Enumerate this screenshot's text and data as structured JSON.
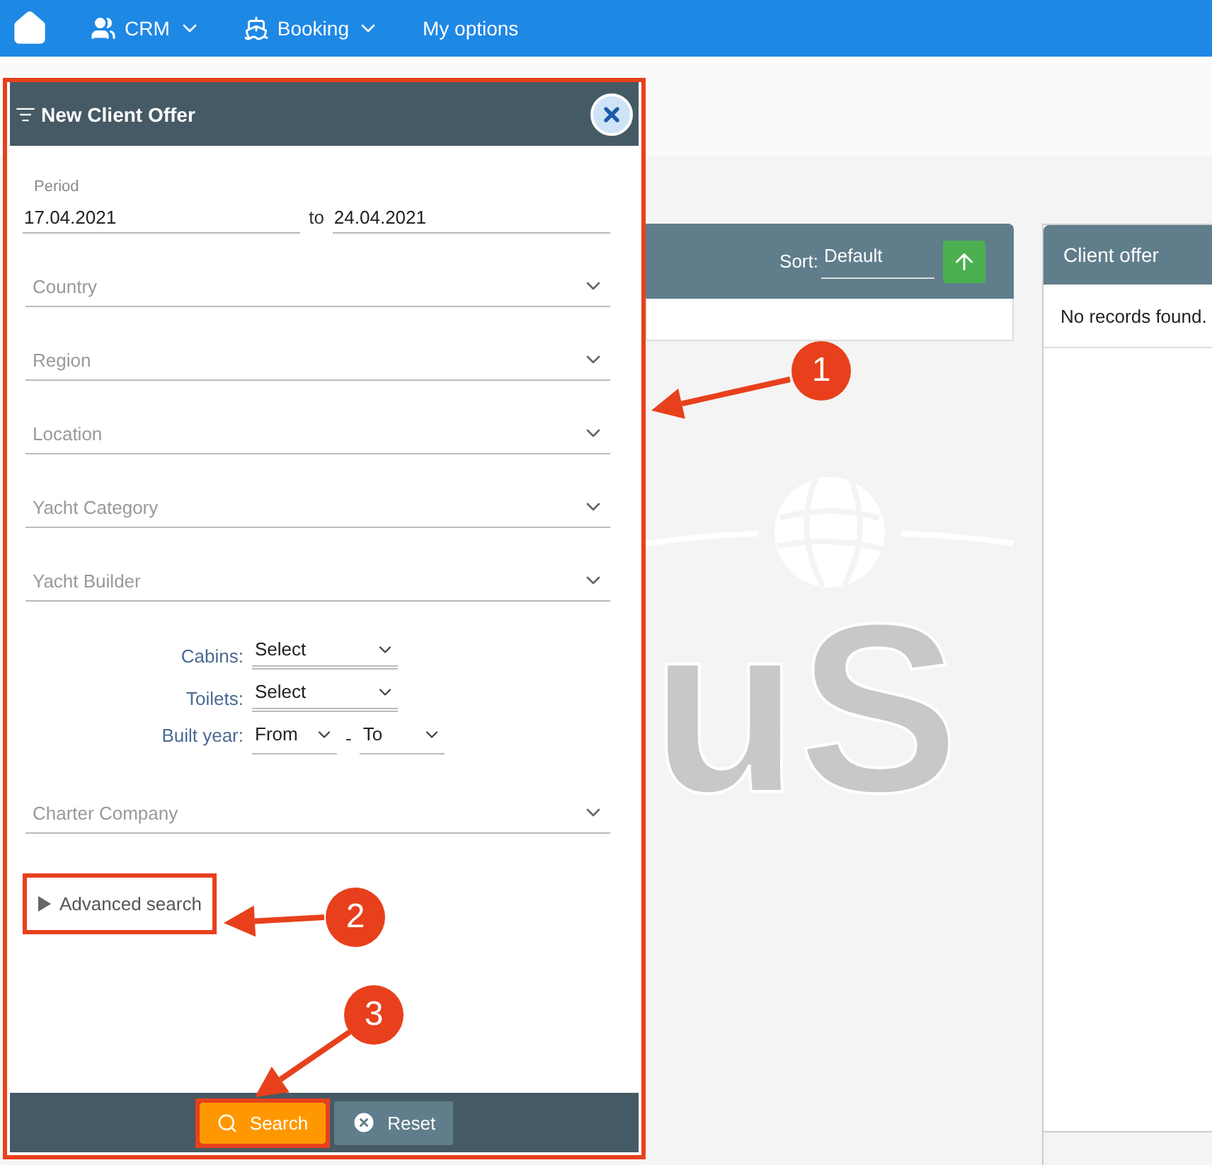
{
  "nav": {
    "items": [
      {
        "label": "CRM",
        "kind": "people",
        "has_menu": true
      },
      {
        "label": "Booking",
        "kind": "ship",
        "has_menu": true
      },
      {
        "label": "My options",
        "kind": "plain",
        "has_menu": false
      }
    ]
  },
  "dialog": {
    "title": "New Client Offer",
    "period": {
      "label": "Period",
      "from": "17.04.2021",
      "separator": "to",
      "to": "24.04.2021"
    },
    "dropdowns_top": [
      {
        "placeholder": "Country"
      },
      {
        "placeholder": "Region"
      },
      {
        "placeholder": "Location"
      },
      {
        "placeholder": "Yacht Category"
      },
      {
        "placeholder": "Yacht Builder"
      }
    ],
    "counts": [
      {
        "label": "Cabins:",
        "value": "Select"
      },
      {
        "label": "Toilets:",
        "value": "Select"
      }
    ],
    "built_year": {
      "label": "Built year:",
      "from": "From",
      "separator": "-",
      "to": "To"
    },
    "dropdowns_bottom": [
      {
        "placeholder": "Charter Company"
      }
    ],
    "advanced": {
      "label": "Advanced search",
      "expanded": false
    },
    "buttons": [
      {
        "label": "Search",
        "kind": "primary"
      },
      {
        "label": "Reset",
        "kind": "secondary"
      }
    ]
  },
  "results": {
    "sort_label": "Sort:",
    "sort_value": "Default"
  },
  "background_logo": {
    "text": "uS"
  },
  "client_offer": {
    "title": "Client offer",
    "empty_text": "No records found."
  },
  "callouts": [
    {
      "number": "1"
    },
    {
      "number": "2"
    },
    {
      "number": "3"
    }
  ]
}
